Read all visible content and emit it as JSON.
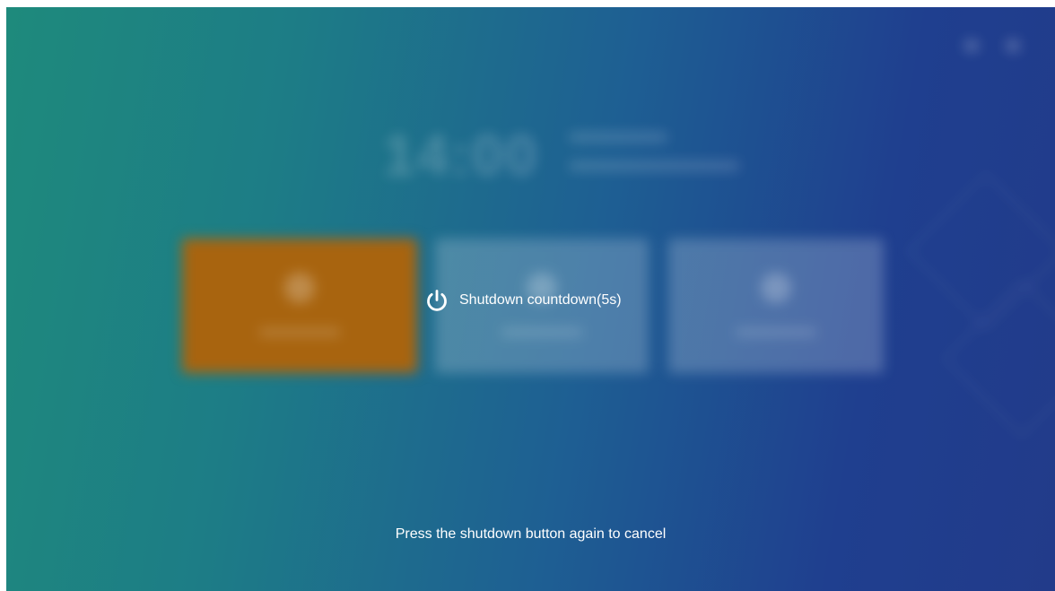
{
  "overlay": {
    "countdown_text": "Shutdown countdown(5s)",
    "countdown_icon": "power-icon",
    "cancel_hint": "Press the shutdown button again to cancel"
  },
  "background": {
    "clock_text": "14:00"
  },
  "colors": {
    "accent_tile": "#a8640f",
    "gradient_start": "#1e8a7c",
    "gradient_end": "#223b8a",
    "text": "#ffffff"
  }
}
